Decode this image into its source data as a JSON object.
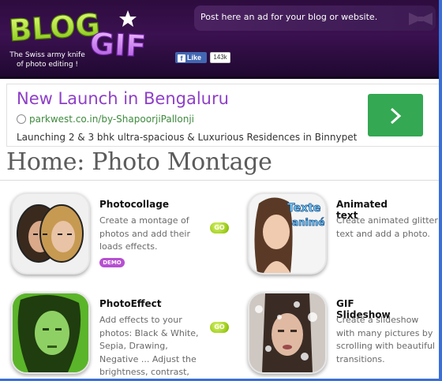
{
  "header": {
    "logo_text_1": "BLOG",
    "logo_text_2": "GIF",
    "tagline": "The Swiss army knife of photo editing !",
    "ad_text": "Post here an ad for your blog or website.",
    "facebook": {
      "like_label": "Like",
      "count": "143k"
    }
  },
  "sponsored": {
    "headline": "New Launch in Bengaluru",
    "url": "parkwest.co.in/by-ShapoorjiPallonji",
    "description": "Launching 2 & 3 bhk ultra-spacious & Luxurious Residences in Binnypet"
  },
  "page": {
    "title": "Home: Photo Montage"
  },
  "thumbnail_text": {
    "texte": "Texte",
    "anime": "animé"
  },
  "tools": [
    {
      "title": "Photocollage",
      "desc": "Create a montage of photos and add their loads effects.",
      "go": "GO",
      "badge": "DEMO"
    },
    {
      "title": "Animated text",
      "desc": "Create animated glitter text and add a photo."
    },
    {
      "title": "PhotoEffect",
      "desc": "Add effects to your photos: Black & White, Sepia, Drawing, Negative ... Adjust the brightness, contrast, tint, ...",
      "go": "GO"
    },
    {
      "title": "GIF Slideshow",
      "desc": "Create a slideshow with many pictures by scrolling with beautiful transitions."
    }
  ],
  "colors": {
    "header_bg": "#3b1150",
    "logo_green": "#9be31a",
    "logo_purple": "#c66df0",
    "ad_headline": "#8e3fc7",
    "ad_url": "#3e8a3e",
    "cta_green": "#34a853",
    "go_green": "#9ccc1a",
    "demo_purple": "#b64fd1"
  }
}
